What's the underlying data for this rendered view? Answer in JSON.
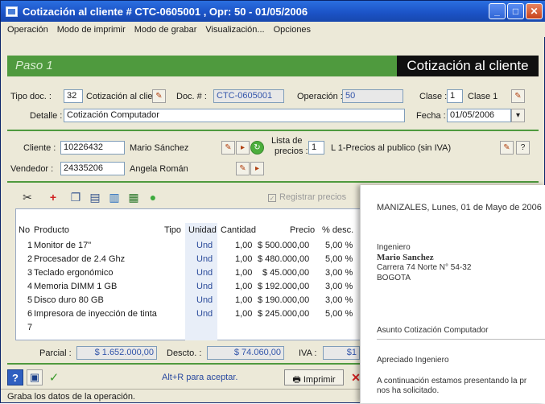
{
  "window": {
    "title": "Cotización al cliente # CTC-0605001 , Opr: 50 - 01/05/2006"
  },
  "menu": [
    "Operación",
    "Modo de imprimir",
    "Modo de grabar",
    "Visualización...",
    "Opciones"
  ],
  "banner": {
    "step": "Paso 1",
    "title": "Cotización al cliente"
  },
  "header": {
    "tipo_doc_label": "Tipo doc. :",
    "tipo_doc_code": "32",
    "tipo_doc_name": "Cotización al clie",
    "doc_label": "Doc. # :",
    "doc_value": "CTC-0605001",
    "operacion_label": "Operación :",
    "operacion_value": "50",
    "clase_label": "Clase :",
    "clase_code": "1",
    "clase_name": "Clase 1",
    "detalle_label": "Detalle :",
    "detalle_value": "Cotización Computador",
    "fecha_label": "Fecha :",
    "fecha_value": "01/05/2006"
  },
  "customer": {
    "cliente_label": "Cliente :",
    "cliente_code": "10226432",
    "cliente_name": "Mario Sánchez",
    "vendedor_label": "Vendedor :",
    "vendedor_code": "24335206",
    "vendedor_name": "Angela Román",
    "lista_label_1": "Lista de",
    "lista_label_2": "precios :",
    "lista_code": "1",
    "lista_name": "L 1-Precios al publico (sin IVA)",
    "help": "?"
  },
  "toolbar": {
    "registrar_label": "Registrar precios"
  },
  "grid": {
    "columns": [
      "No",
      "Producto",
      "Tipo",
      "Unidad",
      "Cantidad",
      "Precio",
      "% desc."
    ],
    "rows": [
      {
        "no": "1",
        "producto": "Monitor de 17\"",
        "tipo": "",
        "unidad": "Und",
        "cantidad": "1,00",
        "precio": "$ 500.000,00",
        "desc": "5,00 %"
      },
      {
        "no": "2",
        "producto": "Procesador de 2.4 Ghz",
        "tipo": "",
        "unidad": "Und",
        "cantidad": "1,00",
        "precio": "$ 480.000,00",
        "desc": "5,00 %"
      },
      {
        "no": "3",
        "producto": "Teclado ergonómico",
        "tipo": "",
        "unidad": "Und",
        "cantidad": "1,00",
        "precio": "$ 45.000,00",
        "desc": "3,00 %"
      },
      {
        "no": "4",
        "producto": "Memoria DIMM 1 GB",
        "tipo": "",
        "unidad": "Und",
        "cantidad": "1,00",
        "precio": "$ 192.000,00",
        "desc": "3,00 %"
      },
      {
        "no": "5",
        "producto": "Disco duro 80 GB",
        "tipo": "",
        "unidad": "Und",
        "cantidad": "1,00",
        "precio": "$ 190.000,00",
        "desc": "3,00 %"
      },
      {
        "no": "6",
        "producto": "Impresora de inyección de tinta",
        "tipo": "",
        "unidad": "Und",
        "cantidad": "1,00",
        "precio": "$ 245.000,00",
        "desc": "5,00 %"
      },
      {
        "no": "7",
        "producto": "",
        "tipo": "",
        "unidad": "",
        "cantidad": "",
        "precio": "",
        "desc": ""
      }
    ]
  },
  "totals": {
    "parcial_label": "Parcial :",
    "parcial_value": "$ 1.652.000,00",
    "descto_label": "Descto. :",
    "descto_value": "$ 74.060,00",
    "iva_label": "IVA :",
    "iva_value": "$1"
  },
  "bottom": {
    "hint": "Alt+R para aceptar.",
    "print_label": "Imprimir"
  },
  "status": "Graba los datos de la operación.",
  "letter": {
    "date": "MANIZALES, Lunes, 01 de Mayo de 2006",
    "title": "Ingeniero",
    "name": "Mario Sanchez",
    "address": "Carrera 74 Norte N° 54-32",
    "city": "BOGOTA",
    "asunto": "Asunto   Cotización Computador",
    "greeting": "Apreciado Ingeniero",
    "body1": "A continuación estamos presentando la pr",
    "body2": "nos ha solicitado."
  }
}
